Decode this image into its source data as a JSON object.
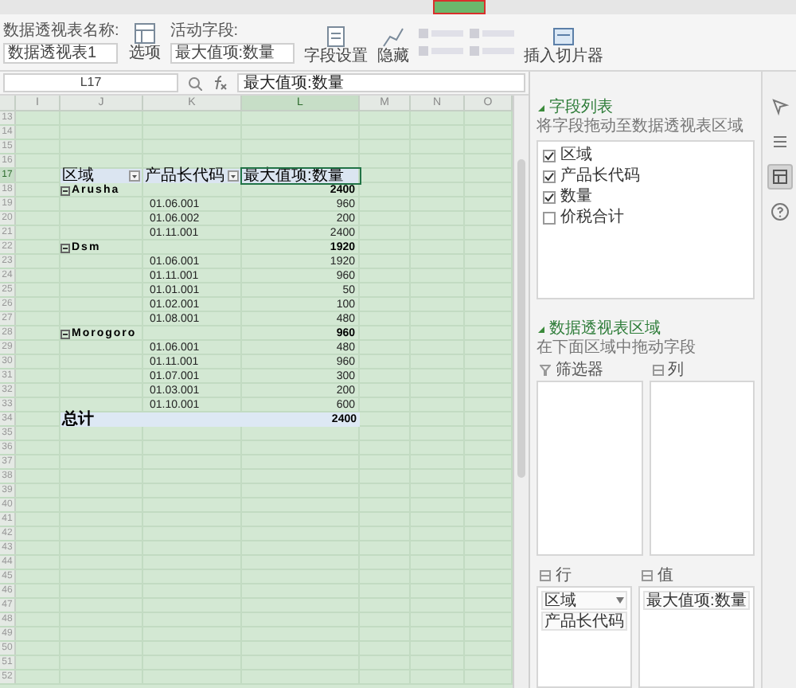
{
  "ribbon": {
    "name_label": "数据透视表名称:",
    "name_value": "数据透视表1",
    "options_button": "选项",
    "active_field_label": "活动字段:",
    "active_field_value": "最大值项:数量",
    "buttons": [
      "字段设置",
      "隐藏"
    ],
    "slicer_button": "插入切片器"
  },
  "formula_bar": {
    "name_box": "L17",
    "formula": "最大值项:数量"
  },
  "sheet": {
    "columns": [
      {
        "label": "I",
        "selected": false
      },
      {
        "label": "J",
        "selected": false
      },
      {
        "label": "K",
        "selected": false
      },
      {
        "label": "L",
        "selected": true
      },
      {
        "label": "M",
        "selected": false
      },
      {
        "label": "N",
        "selected": false
      },
      {
        "label": "O",
        "selected": false
      }
    ],
    "rows": [
      {
        "number": "13",
        "kind": "blank",
        "selected": false
      },
      {
        "number": "14",
        "kind": "blank",
        "selected": false
      },
      {
        "number": "15",
        "kind": "blank",
        "selected": false
      },
      {
        "number": "16",
        "kind": "blank",
        "selected": false
      },
      {
        "number": "17",
        "kind": "header",
        "selected": true,
        "cells": [
          "区域",
          "产品长代码",
          "最大值项:数量"
        ]
      },
      {
        "number": "18",
        "kind": "group",
        "selected": false,
        "expanded": true,
        "label": "Arusha",
        "value": "2400"
      },
      {
        "number": "19",
        "kind": "item",
        "selected": false,
        "code": "01.06.001",
        "value": "960"
      },
      {
        "number": "20",
        "kind": "item",
        "selected": false,
        "code": "01.06.002",
        "value": "200"
      },
      {
        "number": "21",
        "kind": "item",
        "selected": false,
        "code": "01.11.001",
        "value": "2400"
      },
      {
        "number": "22",
        "kind": "group",
        "selected": false,
        "expanded": true,
        "label": "Dsm",
        "value": "1920"
      },
      {
        "number": "23",
        "kind": "item",
        "selected": false,
        "code": "01.06.001",
        "value": "1920"
      },
      {
        "number": "24",
        "kind": "item",
        "selected": false,
        "code": "01.11.001",
        "value": "960"
      },
      {
        "number": "25",
        "kind": "item",
        "selected": false,
        "code": "01.01.001",
        "value": "50"
      },
      {
        "number": "26",
        "kind": "item",
        "selected": false,
        "code": "01.02.001",
        "value": "100"
      },
      {
        "number": "27",
        "kind": "item",
        "selected": false,
        "code": "01.08.001",
        "value": "480"
      },
      {
        "number": "28",
        "kind": "group",
        "selected": false,
        "expanded": true,
        "label": "Morogoro",
        "value": "960"
      },
      {
        "number": "29",
        "kind": "item",
        "selected": false,
        "code": "01.06.001",
        "value": "480"
      },
      {
        "number": "30",
        "kind": "item",
        "selected": false,
        "code": "01.11.001",
        "value": "960"
      },
      {
        "number": "31",
        "kind": "item",
        "selected": false,
        "code": "01.07.001",
        "value": "300"
      },
      {
        "number": "32",
        "kind": "item",
        "selected": false,
        "code": "01.03.001",
        "value": "200"
      },
      {
        "number": "33",
        "kind": "item",
        "selected": false,
        "code": "01.10.001",
        "value": "600"
      },
      {
        "number": "34",
        "kind": "total",
        "selected": false,
        "label": "总计",
        "value": "2400"
      },
      {
        "number": "35",
        "kind": "blank",
        "selected": false
      },
      {
        "number": "36",
        "kind": "blank",
        "selected": false
      },
      {
        "number": "37",
        "kind": "blank",
        "selected": false
      },
      {
        "number": "38",
        "kind": "blank",
        "selected": false
      },
      {
        "number": "39",
        "kind": "blank",
        "selected": false
      },
      {
        "number": "40",
        "kind": "blank",
        "selected": false
      },
      {
        "number": "41",
        "kind": "blank",
        "selected": false
      },
      {
        "number": "42",
        "kind": "blank",
        "selected": false
      },
      {
        "number": "43",
        "kind": "blank",
        "selected": false
      },
      {
        "number": "44",
        "kind": "blank",
        "selected": false
      },
      {
        "number": "45",
        "kind": "blank",
        "selected": false
      },
      {
        "number": "46",
        "kind": "blank",
        "selected": false
      },
      {
        "number": "47",
        "kind": "blank",
        "selected": false
      },
      {
        "number": "48",
        "kind": "blank",
        "selected": false
      },
      {
        "number": "49",
        "kind": "blank",
        "selected": false
      },
      {
        "number": "50",
        "kind": "blank",
        "selected": false
      },
      {
        "number": "51",
        "kind": "blank",
        "selected": false
      },
      {
        "number": "52",
        "kind": "blank",
        "selected": false
      }
    ]
  },
  "panel": {
    "field_list": {
      "title": "字段列表",
      "expanded": true,
      "hint": "将字段拖动至数据透视表区域",
      "fields": [
        {
          "label": "区域",
          "checked": true
        },
        {
          "label": "产品长代码",
          "checked": true
        },
        {
          "label": "数量",
          "checked": true
        },
        {
          "label": "价税合计",
          "checked": false
        }
      ]
    },
    "areas": {
      "title": "数据透视表区域",
      "expanded": true,
      "hint": "在下面区域中拖动字段",
      "filters": {
        "label": "筛选器"
      },
      "columns": {
        "label": "列"
      },
      "rows": {
        "label": "行",
        "items": [
          "区域",
          "产品长代码"
        ]
      },
      "values": {
        "label": "值",
        "items": [
          "最大值项:数量"
        ]
      }
    }
  },
  "side_tabs": [
    {
      "kind": "cursor",
      "selected": false
    },
    {
      "kind": "list",
      "selected": false
    },
    {
      "kind": "pivot",
      "selected": true
    },
    {
      "kind": "help",
      "selected": false
    }
  ]
}
